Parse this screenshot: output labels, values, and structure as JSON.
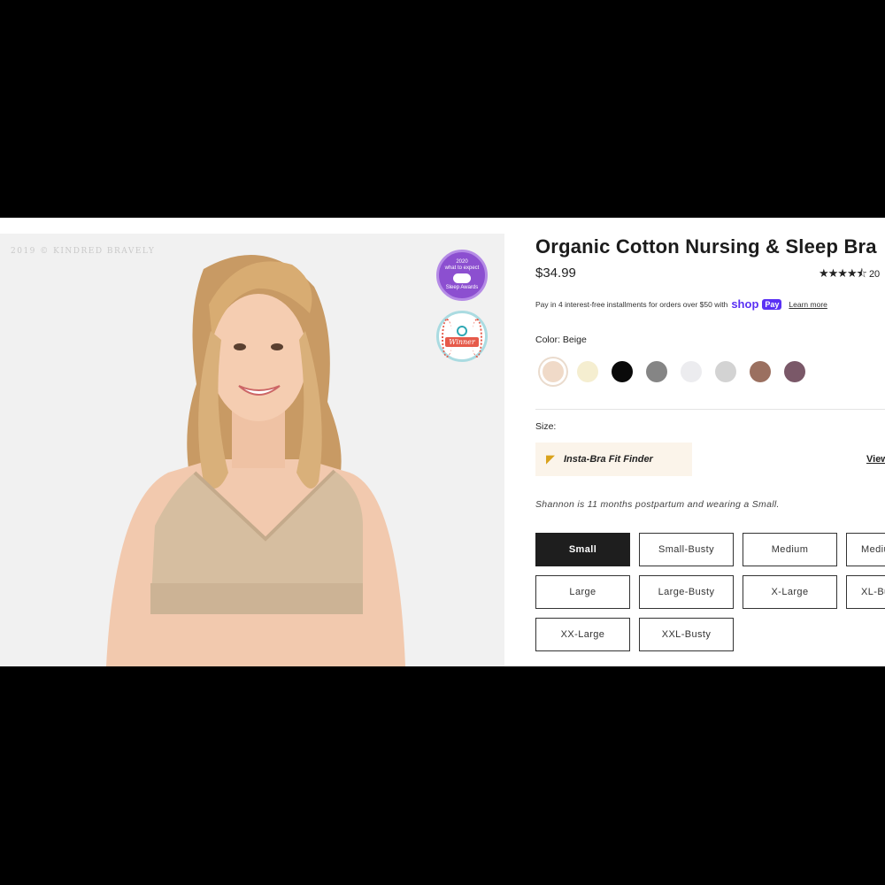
{
  "gallery": {
    "watermark": "2019 © KINDRED BRAVELY",
    "badge_sleep": {
      "year": "2020",
      "brand": "what to expect",
      "award": "Sleep Awards"
    },
    "badge_winner": {
      "label": "Winner"
    }
  },
  "product": {
    "title": "Organic Cotton Nursing & Sleep Bra",
    "price": "$34.99",
    "rating_stars": "★★★★⯪",
    "rating_count_visible": "20",
    "installments": {
      "text": "Pay in 4 interest-free installments for orders over $50 with",
      "shop_word": "shop",
      "pay_word": "Pay",
      "learn_more": "Learn more"
    }
  },
  "color": {
    "label": "Color: Beige",
    "swatches": [
      {
        "name": "Beige",
        "hex": "#f0dac8",
        "selected": true
      },
      {
        "name": "Cream",
        "hex": "#f5eed0"
      },
      {
        "name": "Black",
        "hex": "#0a0a0a"
      },
      {
        "name": "Grey",
        "hex": "#858585"
      },
      {
        "name": "Light Heather",
        "hex": "#ececef"
      },
      {
        "name": "Heather Grey",
        "hex": "#d3d3d3"
      },
      {
        "name": "Mocha",
        "hex": "#9b7060"
      },
      {
        "name": "Plum",
        "hex": "#7a5868"
      }
    ]
  },
  "size": {
    "label": "Size:",
    "fit_finder": "Insta-Bra Fit Finder",
    "view_link": "View",
    "model_note": "Shannon is 11 months postpartum and wearing a Small.",
    "options": [
      "Small",
      "Small-Busty",
      "Medium",
      "Medium-Busty",
      "Large",
      "Large-Busty",
      "X-Large",
      "XL-Busty",
      "XX-Large",
      "XXL-Busty"
    ],
    "selected": "Small"
  }
}
